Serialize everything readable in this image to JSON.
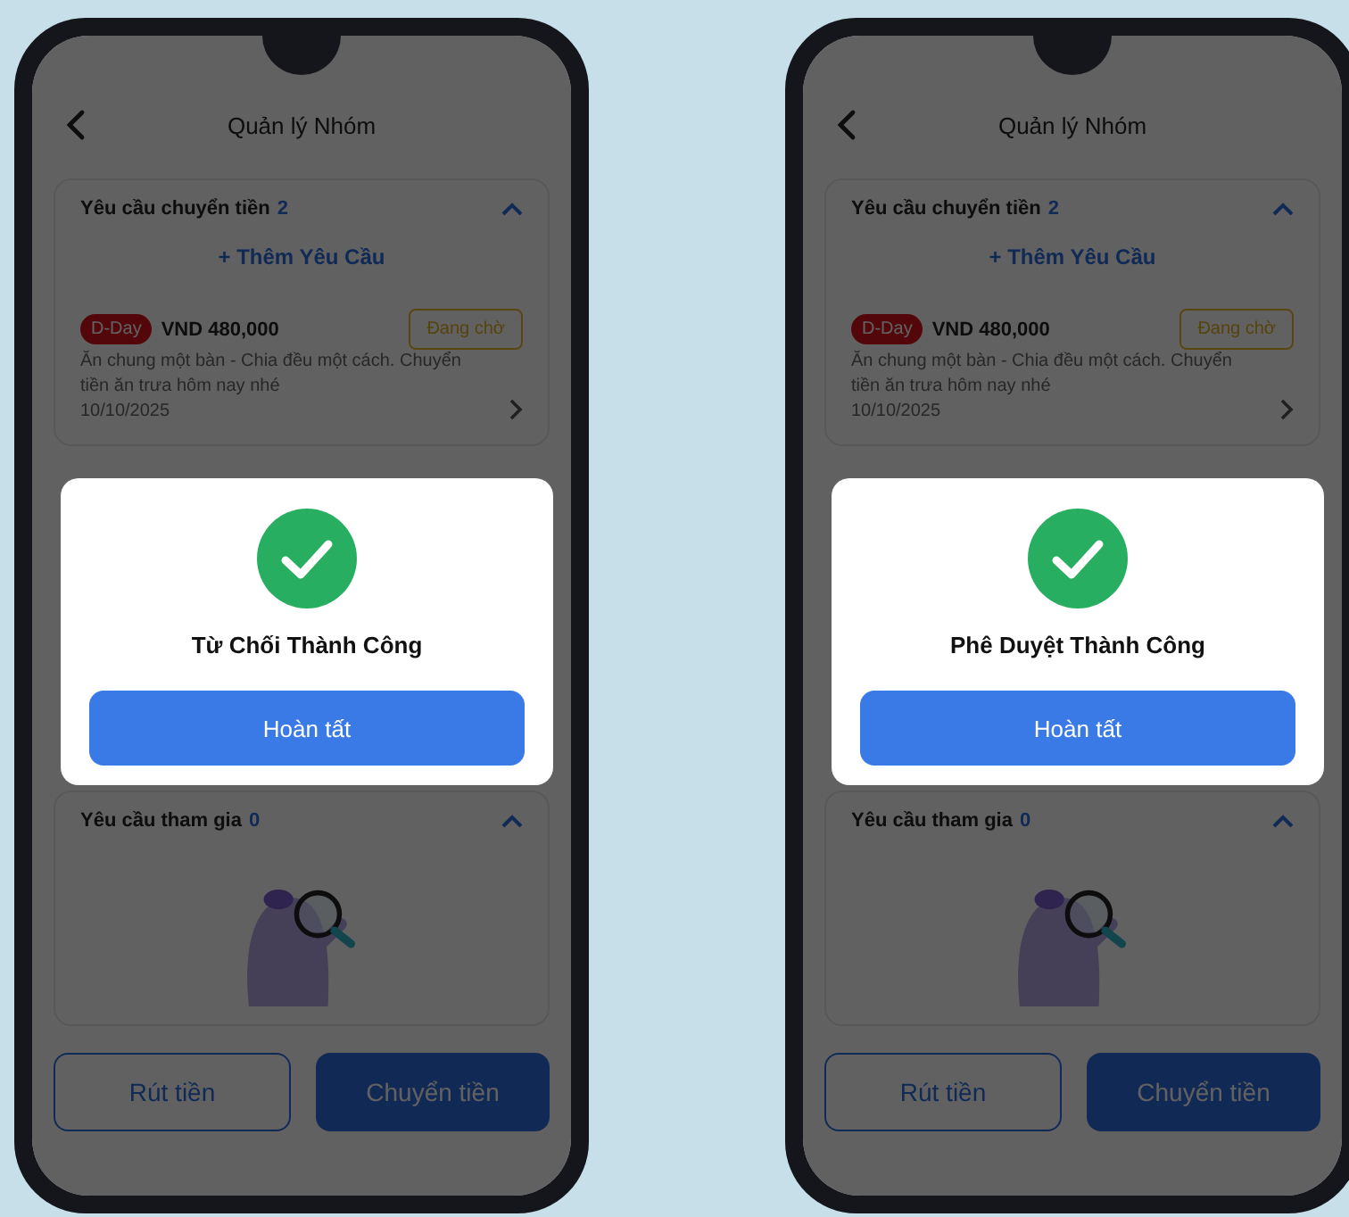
{
  "phones": [
    {
      "title": "Quản lý Nhóm",
      "transfer_requests": {
        "label": "Yêu cầu chuyển tiền",
        "count": "2",
        "expanded": true,
        "add_link": "+ Thêm Yêu Cầu",
        "items": [
          {
            "badge": "D-Day",
            "amount": "VND 480,000",
            "status": "Đang chờ",
            "description": "Ăn chung một bàn - Chia đều một cách. Chuyển tiền ăn trưa hôm nay nhé",
            "date": "10/10/2025"
          }
        ]
      },
      "join_requests": {
        "label": "Yêu cầu tham gia",
        "count": "0",
        "expanded": true
      },
      "buttons": [
        {
          "label": "Rút tiền",
          "kind": "outline"
        },
        {
          "label": "Chuyển tiền",
          "kind": "filled"
        }
      ],
      "dialog": {
        "message": "Từ Chối Thành Công",
        "button": "Hoàn tất"
      }
    },
    {
      "title": "Quản lý Nhóm",
      "transfer_requests": {
        "label": "Yêu cầu chuyển tiền",
        "count": "2",
        "expanded": true,
        "add_link": "+ Thêm Yêu Cầu",
        "items": [
          {
            "badge": "D-Day",
            "amount": "VND 480,000",
            "status": "Đang chờ",
            "description": "Ăn chung một bàn - Chia đều một cách. Chuyển tiền ăn trưa hôm nay nhé",
            "date": "10/10/2025"
          }
        ]
      },
      "join_requests": {
        "label": "Yêu cầu tham gia",
        "count": "0",
        "expanded": true
      },
      "buttons": [
        {
          "label": "Rút tiền",
          "kind": "outline"
        },
        {
          "label": "Chuyển tiền",
          "kind": "filled"
        }
      ],
      "dialog": {
        "message": "Phê Duyệt Thành Công",
        "button": "Hoàn tất"
      }
    }
  ]
}
